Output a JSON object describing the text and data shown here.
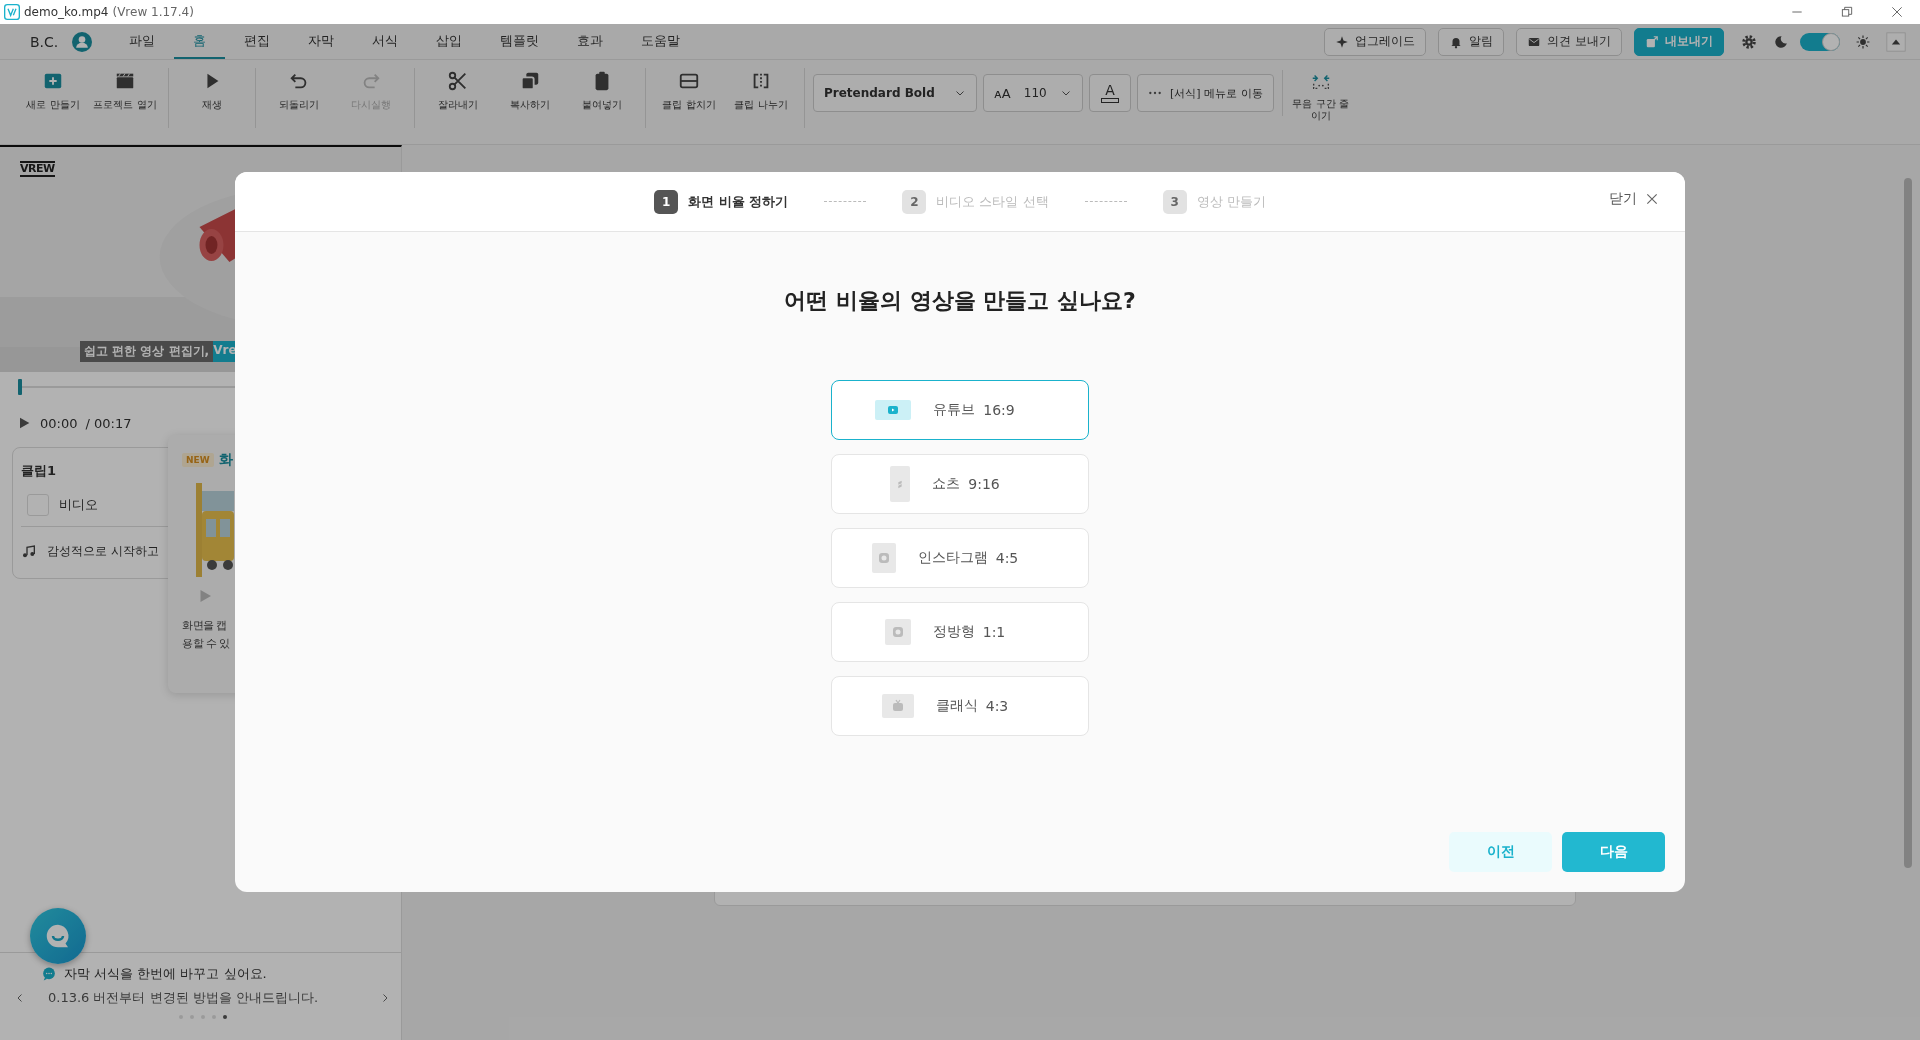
{
  "window": {
    "title": "demo_ko.mp4",
    "version": "(Vrew 1.17.4)"
  },
  "user": {
    "name": "B.C."
  },
  "menu": [
    {
      "label": "파일",
      "selected": false
    },
    {
      "label": "홈",
      "selected": true
    },
    {
      "label": "편집",
      "selected": false
    },
    {
      "label": "자막",
      "selected": false
    },
    {
      "label": "서식",
      "selected": false
    },
    {
      "label": "삽입",
      "selected": false
    },
    {
      "label": "템플릿",
      "selected": false
    },
    {
      "label": "효과",
      "selected": false
    },
    {
      "label": "도움말",
      "selected": false
    }
  ],
  "header_buttons": [
    {
      "kind": "upgrade",
      "label": "업그레이드"
    },
    {
      "kind": "bell",
      "label": "알림"
    },
    {
      "kind": "mail",
      "label": "의견 보내기"
    },
    {
      "kind": "export",
      "label": "내보내기"
    }
  ],
  "theme_toggle": {
    "on": true
  },
  "toolbar": [
    [
      {
        "kind": "new",
        "label": "새로 만들기",
        "disabled": false
      },
      {
        "kind": "open",
        "label": "프로젝트 열기",
        "disabled": false
      }
    ],
    [
      {
        "kind": "play",
        "label": "재생",
        "disabled": false
      }
    ],
    [
      {
        "kind": "undo",
        "label": "되돌리기",
        "disabled": false
      },
      {
        "kind": "redo",
        "label": "다시실행",
        "disabled": true
      }
    ],
    [
      {
        "kind": "cut",
        "label": "잘라내기",
        "disabled": false
      },
      {
        "kind": "copy",
        "label": "복사하기",
        "disabled": false
      },
      {
        "kind": "paste",
        "label": "붙여넣기",
        "disabled": false
      }
    ],
    [
      {
        "kind": "merge",
        "label": "클립 합치기",
        "disabled": false
      },
      {
        "kind": "split",
        "label": "클립 나누기",
        "disabled": false
      }
    ]
  ],
  "format_bar": {
    "font": "Pretendard Bold",
    "size_glyph": "ᴀA",
    "size": "110",
    "color_glyph": "A",
    "move_label": "[서식] 메뉴로 이동"
  },
  "silence_button": {
    "label": "무음 구간 줄이기"
  },
  "preview": {
    "logo": "VREW",
    "caption": "쉽고 편한 영상 편집기, ",
    "caption_highlight": "Vre",
    "current_time": "00:00",
    "total_time": "/ 00:17",
    "progress": {
      "level": 0.01
    }
  },
  "clip": {
    "title": "클립1",
    "video_label": "비디오",
    "music_label": "감성적으로 시작하고"
  },
  "popup": {
    "badge": "NEW",
    "title": "화",
    "lines": [
      "화면을 캡",
      "용할 수 있"
    ]
  },
  "tip": {
    "title": "자막 서식을 한번에 바꾸고 싶어요.",
    "text": "0.13.6 버전부터 변경된 방법을 안내드립니다.",
    "pages": [
      {
        "selected": false
      },
      {
        "selected": false
      },
      {
        "selected": false
      },
      {
        "selected": false
      },
      {
        "selected": true
      }
    ]
  },
  "modal": {
    "steps": [
      {
        "number": "1",
        "label": "화면 비율 정하기",
        "selected": true
      },
      {
        "number": "2",
        "label": "비디오 스타일 선택",
        "selected": false
      },
      {
        "number": "3",
        "label": "영상 만들기",
        "selected": false
      }
    ],
    "close_label": "닫기",
    "question": "어떤 비율의 영상을 만들고 싶나요?",
    "options": [
      {
        "kind": "youtube",
        "name": "유튜브",
        "ratio": "16:9",
        "selected": true
      },
      {
        "kind": "shorts",
        "name": "쇼츠",
        "ratio": "9:16",
        "selected": false
      },
      {
        "kind": "instagram",
        "name": "인스타그램",
        "ratio": "4:5",
        "selected": false
      },
      {
        "kind": "square",
        "name": "정방형",
        "ratio": "1:1",
        "selected": false
      },
      {
        "kind": "classic",
        "name": "클래식",
        "ratio": "4:3",
        "selected": false
      }
    ],
    "prev_label": "이전",
    "next_label": "다음"
  }
}
